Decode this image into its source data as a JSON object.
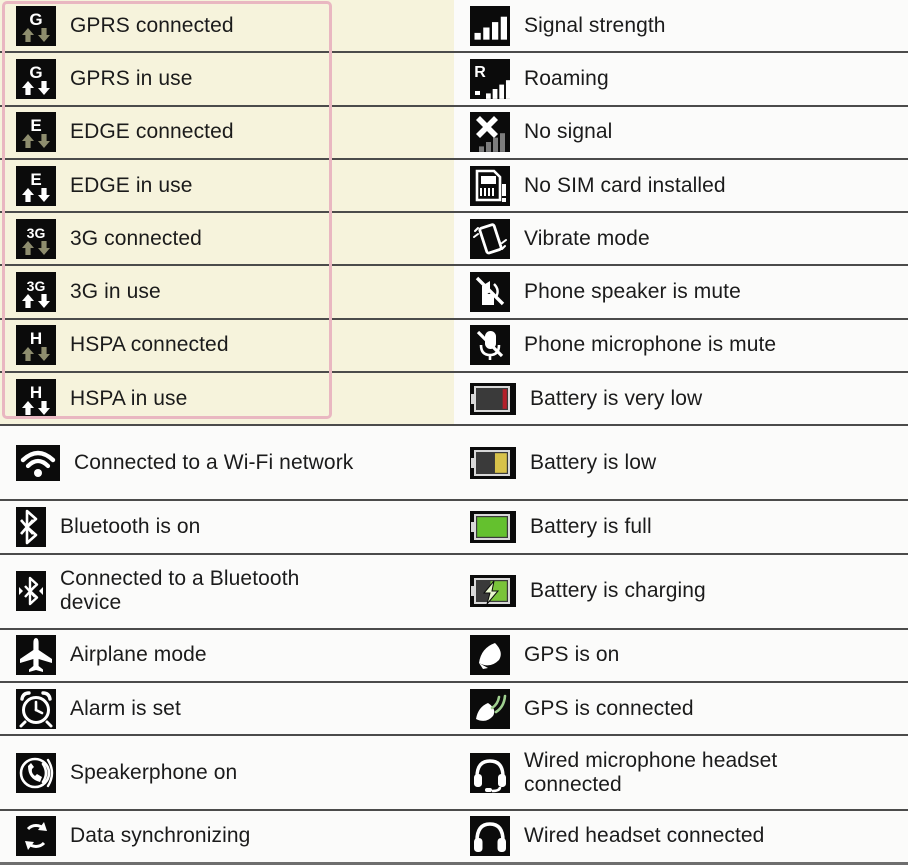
{
  "meta": {
    "title": "Status and notification icons reference",
    "columns": 2,
    "highlight": {
      "label": "mobile-data-rows-highlight",
      "border_color": "#e9b7c1",
      "fill_color": "#f6f3dc",
      "rows_covered": 8
    },
    "colors": {
      "page_background": "#fbfbfa",
      "separator": "#4b4b4b",
      "icon_background": "#0b0b0b",
      "icon_bright": "#ffffff",
      "icon_dim": "#8e8d6e",
      "battery_very_low": "#b3202a",
      "battery_low": "#d8c24a",
      "battery_full": "#64c12e",
      "battery_charging": "#7ac43a",
      "text": "#1b1b1b"
    }
  },
  "rows": [
    {
      "left": {
        "icon": "gprs-connected-icon",
        "label": "GPRS connected",
        "highlighted": true
      },
      "right": {
        "icon": "signal-strength-icon",
        "label": "Signal strength",
        "highlighted": false
      }
    },
    {
      "left": {
        "icon": "gprs-in-use-icon",
        "label": "GPRS in use",
        "highlighted": true
      },
      "right": {
        "icon": "roaming-icon",
        "label": "Roaming",
        "highlighted": false
      }
    },
    {
      "left": {
        "icon": "edge-connected-icon",
        "label": "EDGE connected",
        "highlighted": true
      },
      "right": {
        "icon": "no-signal-icon",
        "label": "No signal",
        "highlighted": false
      }
    },
    {
      "left": {
        "icon": "edge-in-use-icon",
        "label": "EDGE in use",
        "highlighted": true
      },
      "right": {
        "icon": "no-sim-card-icon",
        "label": "No SIM card installed",
        "highlighted": false
      }
    },
    {
      "left": {
        "icon": "3g-connected-icon",
        "label": "3G connected",
        "highlighted": true
      },
      "right": {
        "icon": "vibrate-mode-icon",
        "label": "Vibrate mode",
        "highlighted": false
      }
    },
    {
      "left": {
        "icon": "3g-in-use-icon",
        "label": "3G in use",
        "highlighted": true
      },
      "right": {
        "icon": "speaker-mute-icon",
        "label": "Phone speaker is mute",
        "highlighted": false
      }
    },
    {
      "left": {
        "icon": "hspa-connected-icon",
        "label": "HSPA connected",
        "highlighted": true
      },
      "right": {
        "icon": "microphone-mute-icon",
        "label": "Phone microphone is mute",
        "highlighted": false
      }
    },
    {
      "left": {
        "icon": "hspa-in-use-icon",
        "label": "HSPA in use",
        "highlighted": true
      },
      "right": {
        "icon": "battery-very-low-icon",
        "label": "Battery is very low",
        "highlighted": false
      }
    },
    {
      "left": {
        "icon": "wifi-connected-icon",
        "label": "Connected to a Wi-Fi network",
        "highlighted": false
      },
      "right": {
        "icon": "battery-low-icon",
        "label": "Battery is low",
        "highlighted": false
      }
    },
    {
      "left": {
        "icon": "bluetooth-on-icon",
        "label": "Bluetooth is on",
        "highlighted": false
      },
      "right": {
        "icon": "battery-full-icon",
        "label": "Battery is full",
        "highlighted": false
      }
    },
    {
      "left": {
        "icon": "bluetooth-connected-icon",
        "label": "Connected to a Bluetooth device",
        "highlighted": false
      },
      "right": {
        "icon": "battery-charging-icon",
        "label": "Battery is charging",
        "highlighted": false
      }
    },
    {
      "left": {
        "icon": "airplane-mode-icon",
        "label": "Airplane mode",
        "highlighted": false
      },
      "right": {
        "icon": "gps-on-icon",
        "label": "GPS is on",
        "highlighted": false
      }
    },
    {
      "left": {
        "icon": "alarm-set-icon",
        "label": "Alarm is set",
        "highlighted": false
      },
      "right": {
        "icon": "gps-connected-icon",
        "label": "GPS is connected",
        "highlighted": false
      }
    },
    {
      "left": {
        "icon": "speakerphone-on-icon",
        "label": "Speakerphone on",
        "highlighted": false
      },
      "right": {
        "icon": "wired-mic-headset-icon",
        "label": "Wired microphone headset connected",
        "highlighted": false
      }
    },
    {
      "left": {
        "icon": "data-sync-icon",
        "label": "Data synchronizing",
        "highlighted": false
      },
      "right": {
        "icon": "wired-headset-icon",
        "label": "Wired headset connected",
        "highlighted": false
      }
    }
  ]
}
